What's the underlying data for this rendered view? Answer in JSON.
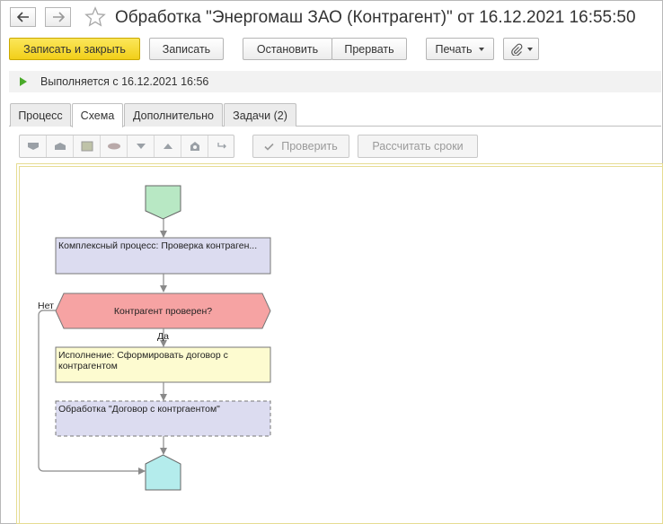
{
  "window": {
    "title": "Обработка \"Энергомаш ЗАО (Контрагент)\" от 16.12.2021 16:55:50"
  },
  "toolbar": {
    "save_close_label": "Записать и закрыть",
    "save_label": "Записать",
    "stop_label": "Остановить",
    "abort_label": "Прервать",
    "print_label": "Печать"
  },
  "status": {
    "text": "Выполняется с 16.12.2021 16:56"
  },
  "tabs": [
    {
      "label": "Процесс"
    },
    {
      "label": "Схема",
      "active": true
    },
    {
      "label": "Дополнительно"
    },
    {
      "label": "Задачи (2)"
    }
  ],
  "schema_toolbar": {
    "check_label": "Проверить",
    "calc_label": "Рассчитать сроки"
  },
  "diagram": {
    "node_complex": "Комплексный процесс: Проверка контраген...",
    "node_condition": "Контрагент проверен?",
    "node_execution": "Исполнение: Сформировать договор с контрагентом",
    "node_processing": "Обработка \"Договор с контргаентом\"",
    "label_no": "Нет",
    "label_yes": "Да"
  },
  "colors": {
    "primary_button": "#f4d228",
    "start_node": "#b8e8c4",
    "process_node": "#dcdcf0",
    "condition_node": "#f6a3a3",
    "execution_node": "#fdfbd0",
    "end_node": "#b4ecec"
  }
}
